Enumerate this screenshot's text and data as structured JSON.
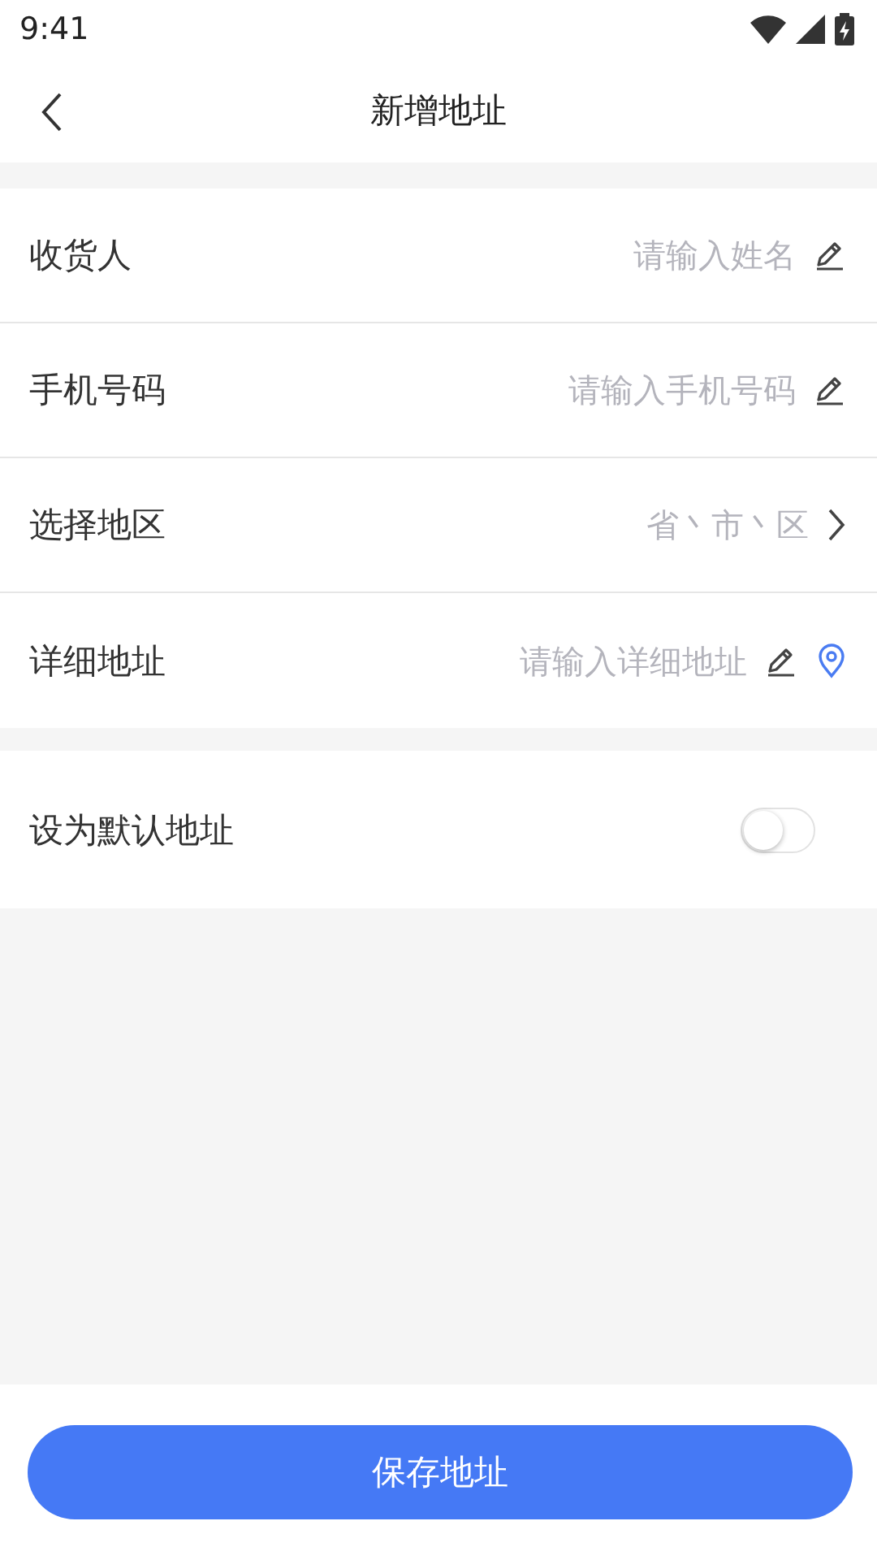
{
  "status_bar": {
    "time": "9:41"
  },
  "header": {
    "title": "新增地址"
  },
  "fields": [
    {
      "kind": "input",
      "label": "收货人",
      "placeholder": "请输入姓名"
    },
    {
      "kind": "input",
      "label": "手机号码",
      "placeholder": "请输入手机号码"
    },
    {
      "kind": "select",
      "label": "选择地区",
      "placeholder": "省丶市丶区"
    },
    {
      "kind": "location",
      "label": "详细地址",
      "placeholder": "请输入详细地址"
    }
  ],
  "default_switch": {
    "label": "设为默认地址",
    "on": false
  },
  "save_button": "保存地址"
}
